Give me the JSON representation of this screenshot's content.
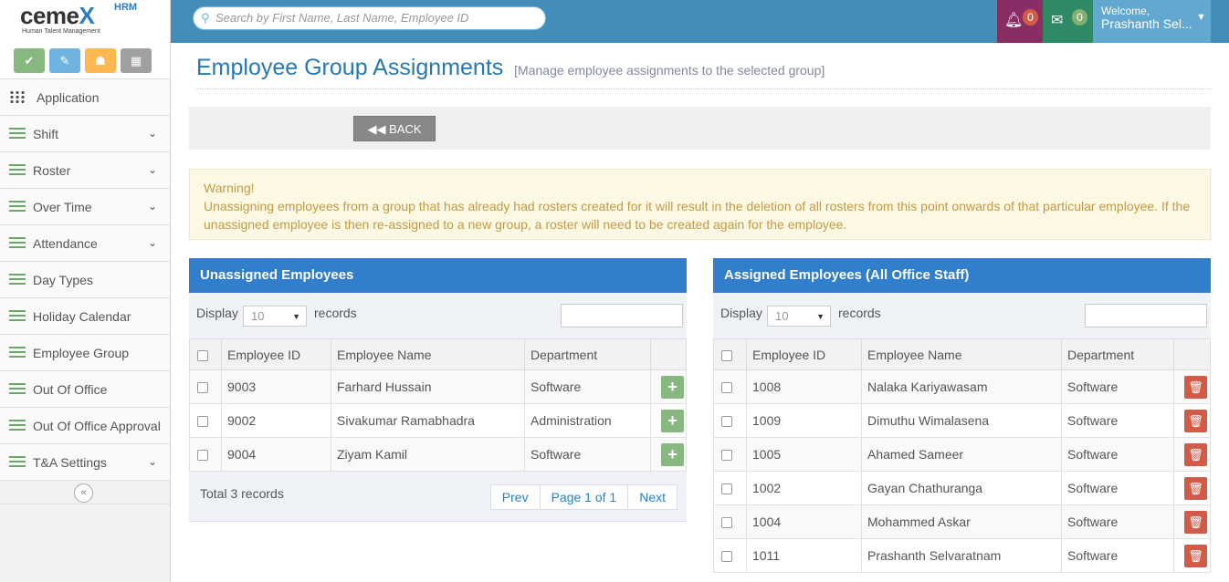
{
  "brand": {
    "name_a": "cem",
    "name_b": "e",
    "name_x": "X",
    "hrm": "HRM",
    "sub": "Human Talent Management"
  },
  "sidebar": {
    "items": [
      {
        "label": "Application",
        "icon": "grid-icon",
        "chevron": false
      },
      {
        "label": "Shift",
        "icon": "list-icon",
        "chevron": true
      },
      {
        "label": "Roster",
        "icon": "list-icon",
        "chevron": true
      },
      {
        "label": "Over Time",
        "icon": "list-icon",
        "chevron": true
      },
      {
        "label": "Attendance",
        "icon": "list-icon",
        "chevron": true
      },
      {
        "label": "Day Types",
        "icon": "list-icon",
        "chevron": false
      },
      {
        "label": "Holiday Calendar",
        "icon": "list-icon",
        "chevron": false
      },
      {
        "label": "Employee Group",
        "icon": "list-icon",
        "chevron": false
      },
      {
        "label": "Out Of Office",
        "icon": "list-icon",
        "chevron": false
      },
      {
        "label": "Out Of Office Approval",
        "icon": "list-icon",
        "chevron": false
      },
      {
        "label": "T&A Settings",
        "icon": "list-icon",
        "chevron": true
      }
    ],
    "collapse_icon": "«",
    "chevron": "⌄"
  },
  "topbar": {
    "search_placeholder": "Search by First Name, Last Name, Employee ID",
    "notifications_count": "0",
    "messages_count": "0",
    "welcome": "Welcome,",
    "user_name": "Prashanth Sel...",
    "colors": {
      "bar": "#438eb9",
      "notif": "#892e65",
      "msg": "#2e8965",
      "user": "#62a8d1"
    }
  },
  "page": {
    "title": "Employee Group Assignments",
    "subtitle": "[Manage employee assignments to the selected group]",
    "back_label": "BACK"
  },
  "warning": {
    "title": "Warning!",
    "text": "Unassigning employees from a group that has already had rosters created for it will result in the deletion of all rosters from this point onwards of that particular employee. If the unassigned employee is then re-assigned to a new group, a roster will need to be created again for the employee."
  },
  "unassigned": {
    "header": "Unassigned Employees",
    "display_label": "Display",
    "page_size": "10",
    "records_label": "records",
    "columns": [
      "Employee ID",
      "Employee Name",
      "Department"
    ],
    "rows": [
      {
        "id": "9003",
        "name": "Farhard Hussain",
        "dept": "Software"
      },
      {
        "id": "9002",
        "name": "Sivakumar Ramabhadra",
        "dept": "Administration"
      },
      {
        "id": "9004",
        "name": "Ziyam Kamil",
        "dept": "Software"
      }
    ],
    "total": "Total 3 records",
    "prev": "Prev",
    "page_info": "Page 1 of 1",
    "next": "Next"
  },
  "assigned": {
    "header": "Assigned Employees (All Office Staff)",
    "display_label": "Display",
    "page_size": "10",
    "records_label": "records",
    "columns": [
      "Employee ID",
      "Employee Name",
      "Department"
    ],
    "rows": [
      {
        "id": "1008",
        "name": "Nalaka Kariyawasam",
        "dept": "Software"
      },
      {
        "id": "1009",
        "name": "Dimuthu Wimalasena",
        "dept": "Software"
      },
      {
        "id": "1005",
        "name": "Ahamed Sameer",
        "dept": "Software"
      },
      {
        "id": "1002",
        "name": "Gayan Chathuranga",
        "dept": "Software"
      },
      {
        "id": "1004",
        "name": "Mohammed Askar",
        "dept": "Software"
      },
      {
        "id": "1011",
        "name": "Prashanth Selvaratnam",
        "dept": "Software"
      }
    ]
  }
}
